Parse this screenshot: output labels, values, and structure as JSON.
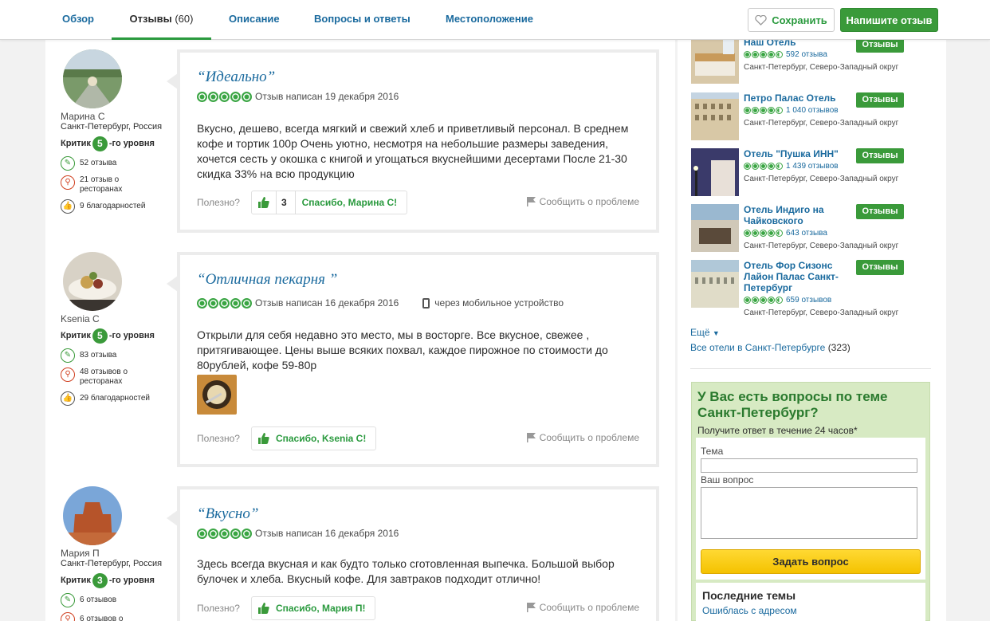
{
  "tabs": [
    {
      "label": "Обзор"
    },
    {
      "label": "Отзывы",
      "count": "(60)"
    },
    {
      "label": "Описание"
    },
    {
      "label": "Вопросы и ответы"
    },
    {
      "label": "Местоположение"
    }
  ],
  "header": {
    "save_label": "Сохранить",
    "write_label": "Напишите отзыв"
  },
  "reviews": [
    {
      "reviewer": {
        "name": "Марина С",
        "location": "Санкт-Петербург, Россия",
        "level_prefix": "Критик",
        "level": "5",
        "level_suffix": "-го уровня",
        "stats": [
          "52 отзыва",
          "21 отзыв о ресторанах",
          "9 благодарностей"
        ]
      },
      "title": "“Идеально”",
      "rating": 5,
      "date": "Отзыв написан 19 декабря 2016",
      "text": "Вкусно, дешево, всегда мягкий и свежий хлеб и приветливый персонал. В среднем кофе и тортик 100р Очень уютно, несмотря на небольшие размеры заведения, хочется сесть у окошка с книгой и угощаться вкуснейшими десертами После 21-30 скидка 33% на всю продукцию",
      "helpful_label": "Полезно?",
      "votes": "3",
      "thanks": "Спасибо, Марина С!",
      "report": "Сообщить о проблеме"
    },
    {
      "reviewer": {
        "name": "Ksenia C",
        "location": "",
        "level_prefix": "Критик",
        "level": "5",
        "level_suffix": "-го уровня",
        "stats": [
          "83 отзыва",
          "48 отзывов о ресторанах",
          "29 благодарностей"
        ]
      },
      "title": "“Отличная пекарня ”",
      "rating": 5,
      "date": "Отзыв написан 16 декабря 2016",
      "mobile": "через мобильное устройство",
      "text": "Открыли для себя недавно это место, мы в восторге. Все вкусное, свежее , притягивающее. Цены выше всяких похвал, каждое пирожное по стоимости до 80рублей, кофе 59-80р",
      "helpful_label": "Полезно?",
      "thanks": "Спасибо, Ksenia C!",
      "report": "Сообщить о проблеме"
    },
    {
      "reviewer": {
        "name": "Мария П",
        "location": "Санкт-Петербург, Россия",
        "level_prefix": "Критик",
        "level": "3",
        "level_suffix": "-го уровня",
        "stats": [
          "6 отзывов",
          "6 отзывов о"
        ]
      },
      "title": "“Вкусно”",
      "rating": 5,
      "date": "Отзыв написан 16 декабря 2016",
      "text": "Здесь всегда вкусная и как будто только сготовленная выпечка. Большой выбор булочек и хлеба. Вкусный кофе. Для завтраков подходит отлично!",
      "helpful_label": "Полезно?",
      "thanks": "Спасибо, Мария П!",
      "report": "Сообщить о проблеме"
    }
  ],
  "hotels": [
    {
      "name": "Наш Отель",
      "reviews": "592 отзыва",
      "location": "Санкт-Петербург, Северо-Западный округ",
      "button": "Отзывы",
      "rating": 4.5
    },
    {
      "name": "Петро Палас Отель",
      "reviews": "1 040 отзывов",
      "location": "Санкт-Петербург, Северо-Западный округ",
      "button": "Отзывы",
      "rating": 4.5
    },
    {
      "name": "Отель \"Пушка ИНН\"",
      "reviews": "1 439 отзывов",
      "location": "Санкт-Петербург, Северо-Западный округ",
      "button": "Отзывы",
      "rating": 4.5
    },
    {
      "name": "Отель Индиго на Чайковского",
      "reviews": "643 отзыва",
      "location": "Санкт-Петербург, Северо-Западный округ",
      "button": "Отзывы",
      "rating": 4.5
    },
    {
      "name": "Отель Фор Сизонс Лайон Палас Санкт-Петербург",
      "reviews": "659 отзывов",
      "location": "Санкт-Петербург, Северо-Западный округ",
      "button": "Отзывы",
      "rating": 4.5
    }
  ],
  "side": {
    "more": "Ещё",
    "all_hotels": "Все отели в Санкт-Петербурге",
    "all_hotels_count": "(323)"
  },
  "qa": {
    "title": "У Вас есть вопросы по теме Санкт-Петербург?",
    "subtitle": "Получите ответ в течение 24 часов*",
    "topic_label": "Тема",
    "question_label": "Ваш вопрос",
    "ask_button": "Задать вопрос",
    "recent_title": "Последние темы",
    "recent_item": "Ошиблась с адресом"
  },
  "colors": {
    "accent_green": "#3a9a3a",
    "link_blue": "#1a6a9e",
    "qa_bg": "#d7eac3",
    "ask_yellow": "#f4c200"
  }
}
